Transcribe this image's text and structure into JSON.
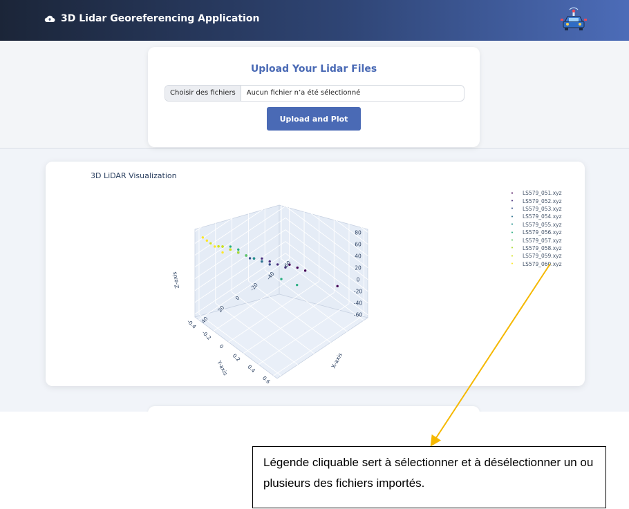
{
  "header": {
    "title": "3D Lidar Georeferencing Application",
    "accent": "#4a6ab5",
    "icon": "cloud-icon",
    "logo": "car-logo"
  },
  "upload": {
    "title": "Upload Your Lidar Files",
    "file_button_label": "Choisir des fichiers",
    "file_status": "Aucun fichier n’a été sélectionné",
    "upload_button_label": "Upload and Plot"
  },
  "visualization": {
    "title": "3D LiDAR Visualization",
    "legend": [
      {
        "label": "LS579_051.xyz",
        "color": "#440154"
      },
      {
        "label": "LS579_052.xyz",
        "color": "#472d7b"
      },
      {
        "label": "LS579_053.xyz",
        "color": "#3b528b"
      },
      {
        "label": "LS579_054.xyz",
        "color": "#2c728e"
      },
      {
        "label": "LS579_055.xyz",
        "color": "#21918c"
      },
      {
        "label": "LS579_056.xyz",
        "color": "#28ae80"
      },
      {
        "label": "LS579_057.xyz",
        "color": "#5ec962"
      },
      {
        "label": "LS579_058.xyz",
        "color": "#addc30"
      },
      {
        "label": "LS579_059.xyz",
        "color": "#d4e21a"
      },
      {
        "label": "LS579_060.xyz",
        "color": "#fde725"
      }
    ]
  },
  "chart_data": {
    "type": "scatter",
    "dimensions": "3d",
    "title": "3D LiDAR Visualization",
    "xlabel": "X-axis",
    "ylabel": "Y-axis",
    "zlabel": "Z-axis",
    "x_ticks": [
      "-60",
      "-40",
      "-20",
      "0",
      "20",
      "40"
    ],
    "y_ticks": [
      "-0.4",
      "-0.2",
      "0",
      "0.2",
      "0.4",
      "0.6"
    ],
    "z_ticks": [
      "80",
      "60",
      "40",
      "20",
      "0",
      "-20",
      "-40",
      "-60"
    ],
    "xlim": [
      -65,
      45
    ],
    "ylim": [
      -0.45,
      0.65
    ],
    "zlim": [
      -65,
      85
    ],
    "colorscale": "viridis",
    "series": [
      {
        "name": "LS579_051.xyz",
        "x": [
          -60,
          -30,
          -25,
          -20
        ],
        "y": [
          0.3,
          0.2,
          0.15,
          0.1
        ],
        "z": [
          -40,
          5,
          10,
          15
        ]
      },
      {
        "name": "LS579_052.xyz",
        "x": [
          -15,
          -10,
          -5,
          0
        ],
        "y": [
          0.1,
          0.05,
          0,
          -0.05
        ],
        "z": [
          15,
          20,
          25,
          30
        ]
      },
      {
        "name": "LS579_053.xyz",
        "x": [
          -5,
          0,
          5,
          10
        ],
        "y": [
          0,
          -0.05,
          -0.1,
          -0.1
        ],
        "z": [
          20,
          25,
          30,
          35
        ]
      },
      {
        "name": "LS579_054.xyz",
        "x": [
          0,
          5,
          10,
          15
        ],
        "y": [
          -0.05,
          -0.1,
          -0.15,
          -0.2
        ],
        "z": [
          25,
          30,
          35,
          40
        ]
      },
      {
        "name": "LS579_055.xyz",
        "x": [
          5,
          10,
          15,
          20
        ],
        "y": [
          -0.1,
          -0.15,
          -0.2,
          -0.25
        ],
        "z": [
          30,
          35,
          40,
          45
        ]
      },
      {
        "name": "LS579_056.xyz",
        "x": [
          -20,
          -10,
          15,
          20
        ],
        "y": [
          0.2,
          0.1,
          -0.2,
          -0.25
        ],
        "z": [
          -10,
          0,
          45,
          50
        ]
      },
      {
        "name": "LS579_057.xyz",
        "x": [
          10,
          15,
          20,
          25
        ],
        "y": [
          -0.15,
          -0.2,
          -0.25,
          -0.3
        ],
        "z": [
          35,
          40,
          45,
          50
        ]
      },
      {
        "name": "LS579_058.xyz",
        "x": [
          15,
          20,
          25,
          30
        ],
        "y": [
          -0.2,
          -0.25,
          -0.3,
          -0.3
        ],
        "z": [
          40,
          45,
          50,
          55
        ]
      },
      {
        "name": "LS579_059.xyz",
        "x": [
          20,
          25,
          30,
          35
        ],
        "y": [
          -0.25,
          -0.3,
          -0.3,
          -0.35
        ],
        "z": [
          45,
          50,
          55,
          60
        ]
      },
      {
        "name": "LS579_060.xyz",
        "x": [
          25,
          30,
          35,
          40
        ],
        "y": [
          -0.3,
          -0.35,
          -0.4,
          -0.4
        ],
        "z": [
          40,
          50,
          60,
          70
        ]
      }
    ]
  },
  "annotation": {
    "text": "Légende cliquable sert à sélectionner et à désélectionner un ou plusieurs des fichiers importés.",
    "arrow_color": "#f5b800"
  }
}
